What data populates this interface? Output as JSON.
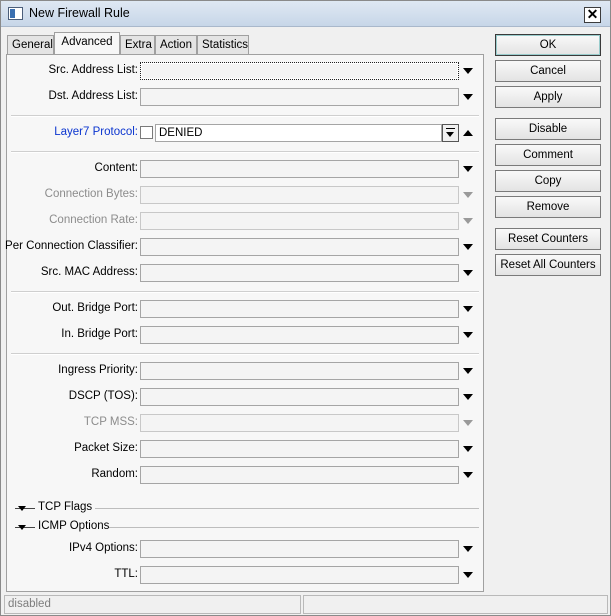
{
  "window": {
    "title": "New Firewall Rule"
  },
  "tabs": [
    {
      "label": "General",
      "active": false
    },
    {
      "label": "Advanced",
      "active": true
    },
    {
      "label": "Extra",
      "active": false
    },
    {
      "label": "Action",
      "active": false
    },
    {
      "label": "Statistics",
      "active": false
    }
  ],
  "fields": {
    "src_address_list": {
      "label": "Src. Address List:",
      "value": ""
    },
    "dst_address_list": {
      "label": "Dst. Address List:",
      "value": ""
    },
    "layer7_protocol": {
      "label": "Layer7 Protocol:",
      "value": "DENIED",
      "negate_checked": false
    },
    "content": {
      "label": "Content:",
      "value": ""
    },
    "connection_bytes": {
      "label": "Connection Bytes:",
      "value": ""
    },
    "connection_rate": {
      "label": "Connection Rate:",
      "value": ""
    },
    "per_connection_classifier": {
      "label": "Per Connection Classifier:",
      "value": ""
    },
    "src_mac_address": {
      "label": "Src. MAC Address:",
      "value": ""
    },
    "out_bridge_port": {
      "label": "Out. Bridge Port:",
      "value": ""
    },
    "in_bridge_port": {
      "label": "In. Bridge Port:",
      "value": ""
    },
    "ingress_priority": {
      "label": "Ingress Priority:",
      "value": ""
    },
    "dscp_tos": {
      "label": "DSCP (TOS):",
      "value": ""
    },
    "tcp_mss": {
      "label": "TCP MSS:",
      "value": ""
    },
    "packet_size": {
      "label": "Packet Size:",
      "value": ""
    },
    "random": {
      "label": "Random:",
      "value": ""
    },
    "ipv4_options": {
      "label": "IPv4 Options:",
      "value": ""
    },
    "ttl": {
      "label": "TTL:",
      "value": ""
    }
  },
  "sections": {
    "tcp_flags": "TCP Flags",
    "icmp_options": "ICMP Options"
  },
  "buttons": {
    "ok": "OK",
    "cancel": "Cancel",
    "apply": "Apply",
    "disable": "Disable",
    "comment": "Comment",
    "copy": "Copy",
    "remove": "Remove",
    "reset_counters": "Reset Counters",
    "reset_all_counters": "Reset All Counters"
  },
  "status": {
    "state": "disabled",
    "secondary": ""
  },
  "colors": {
    "link": "#0b35cf",
    "disabled_text": "#8c8c8c",
    "titlebar": "#c7d6e8"
  }
}
